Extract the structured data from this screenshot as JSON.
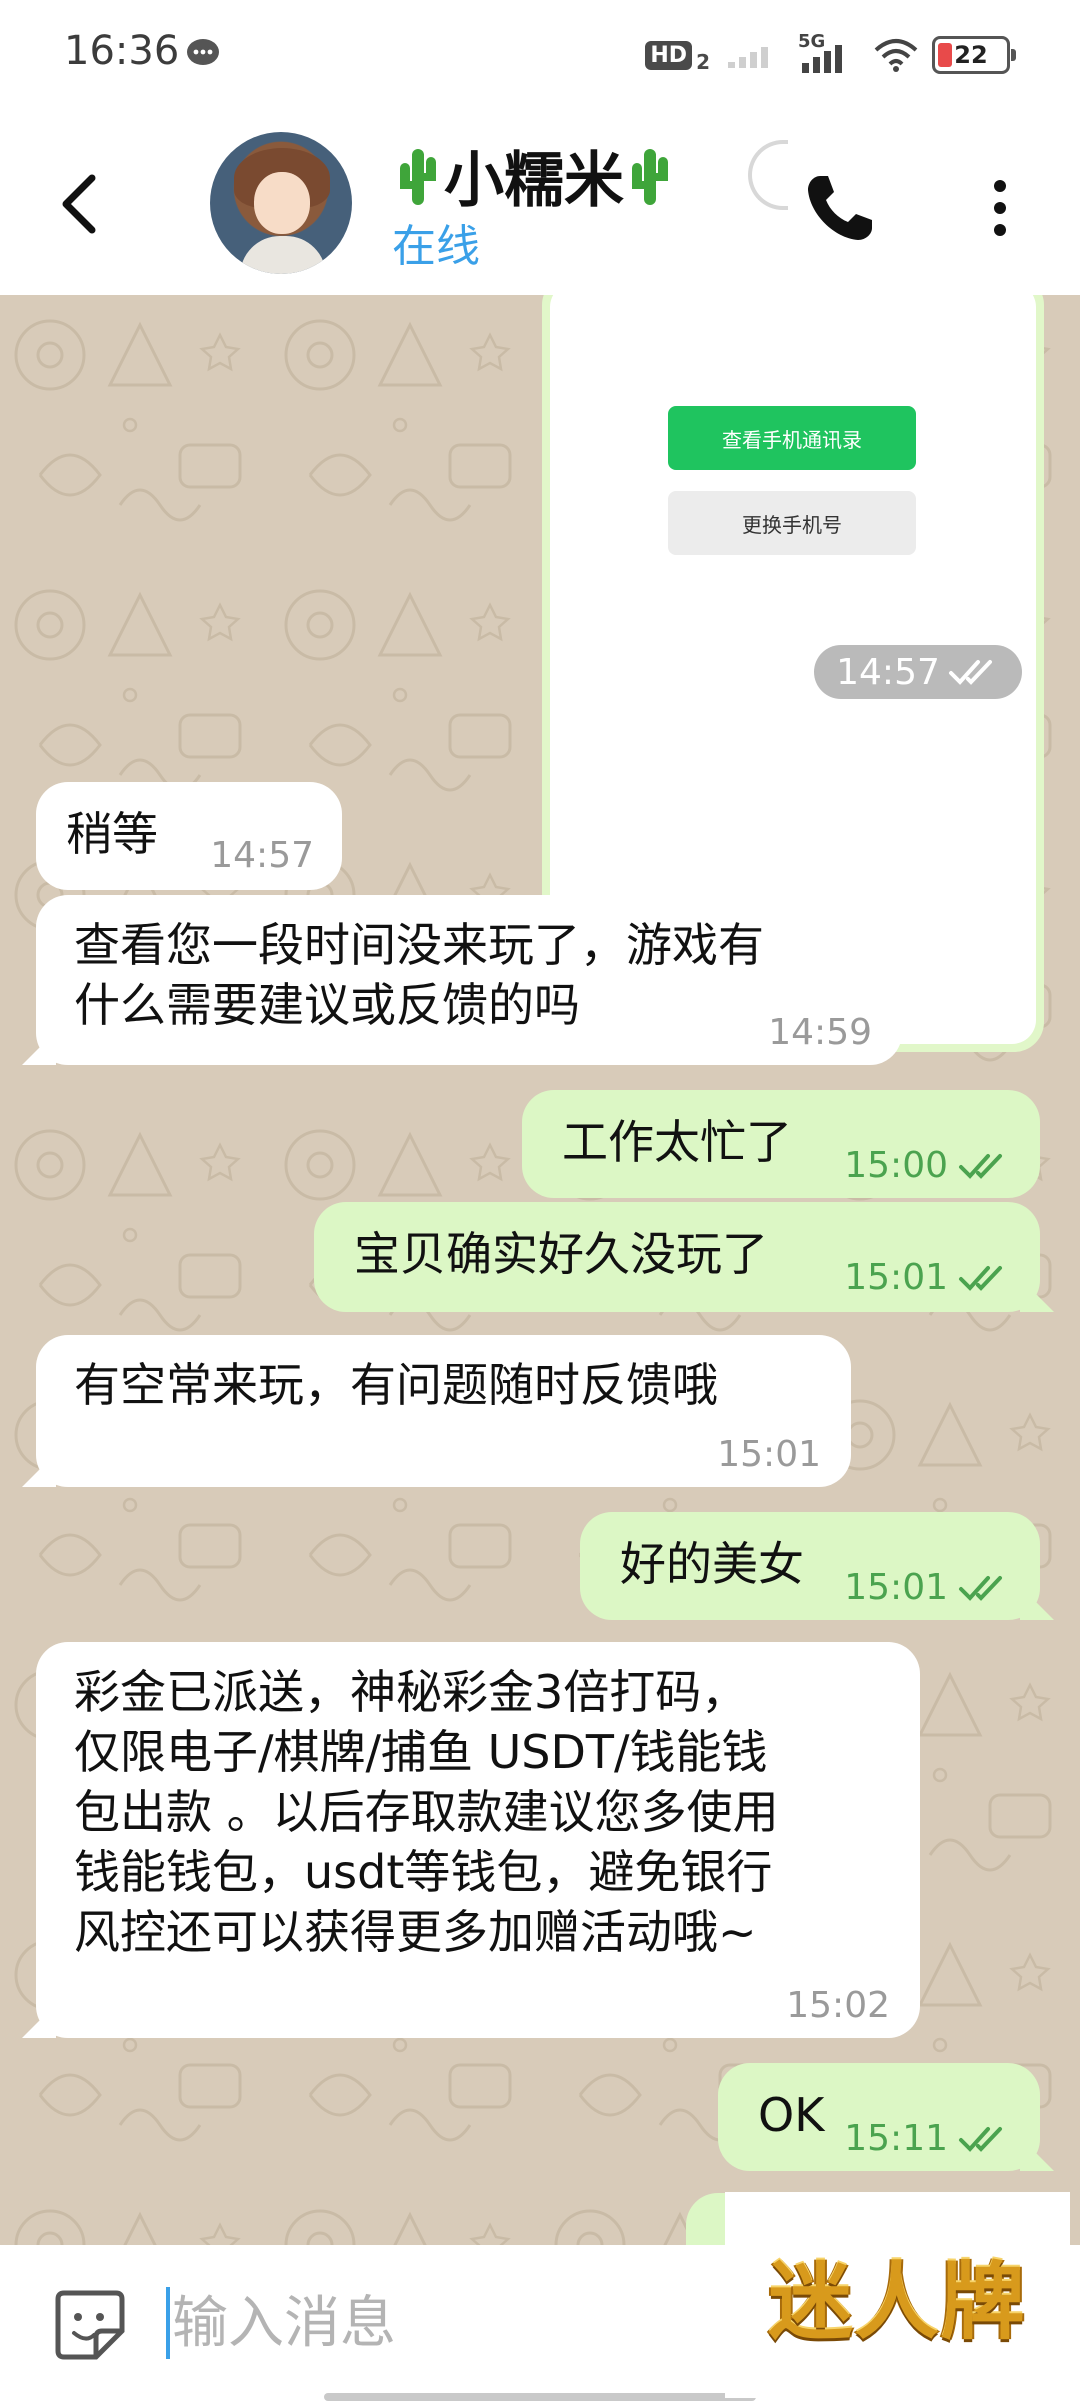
{
  "status_bar": {
    "time": "16:36",
    "network": "5G",
    "battery_level": "22",
    "icons": [
      "message-icon",
      "hd-icon",
      "signal-icon",
      "wifi-icon",
      "battery-icon"
    ]
  },
  "header": {
    "contact_name": "小糯米",
    "name_decoration": "cactus-icon",
    "status": "在线",
    "icons": [
      "back-icon",
      "avatar",
      "phone-icon",
      "more-vert-icon"
    ]
  },
  "messages": [
    {
      "type": "image",
      "direction": "out",
      "image_buttons": {
        "primary": "查看手机通讯录",
        "secondary": "更换手机号"
      },
      "time": "14:57",
      "read": true
    },
    {
      "type": "text",
      "direction": "in",
      "lines": [
        "稍等"
      ],
      "time": "14:57"
    },
    {
      "type": "text",
      "direction": "in",
      "lines": [
        "查看您一段时间没来玩了，游戏有",
        "什么需要建议或反馈的吗"
      ],
      "time": "14:59"
    },
    {
      "type": "text",
      "direction": "out",
      "lines": [
        "工作太忙了"
      ],
      "time": "15:00",
      "read": true
    },
    {
      "type": "text",
      "direction": "out",
      "lines": [
        "宝贝确实好久没玩了"
      ],
      "time": "15:01",
      "read": true
    },
    {
      "type": "text",
      "direction": "in",
      "lines": [
        "有空常来玩，有问题随时反馈哦"
      ],
      "time": "15:01"
    },
    {
      "type": "text",
      "direction": "out",
      "lines": [
        "好的美女"
      ],
      "time": "15:01",
      "read": true
    },
    {
      "type": "text",
      "direction": "in",
      "lines": [
        "彩金已派送，神秘彩金3倍打码，",
        "仅限电子/棋牌/捕鱼 USDT/钱能钱",
        "包出款 。以后存取款建议您多使用",
        "钱能钱包，usdt等钱包，避免银行",
        "风控还可以获得更多加赠活动哦~"
      ],
      "time": "15:02"
    },
    {
      "type": "text",
      "direction": "out",
      "lines": [
        "OK"
      ],
      "time": "15:11",
      "read": true
    }
  ],
  "input": {
    "placeholder": "输入消息",
    "value": ""
  },
  "watermark": {
    "text": "迷人牌"
  },
  "colors": {
    "chat_background": "#d8cbb9",
    "outgoing_bubble": "#dcf7c5",
    "incoming_bubble": "#ffffff",
    "status_online": "#3aa0e8",
    "read_tick": "#4ba34f",
    "image_primary_button": "#1fc45f"
  }
}
